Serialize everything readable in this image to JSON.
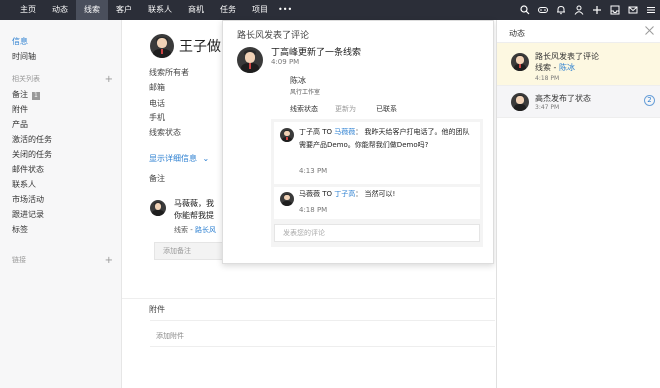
{
  "nav": {
    "items": [
      "主页",
      "动态",
      "线索",
      "客户",
      "联系人",
      "商机",
      "任务",
      "项目"
    ],
    "more": "•••"
  },
  "sidebar": {
    "top_items": [
      "信息",
      "时间轴"
    ],
    "group_label": "相关列表",
    "list_items": [
      "备注",
      "附件",
      "产品",
      "激活的任务",
      "关闭的任务",
      "邮件状态",
      "联系人",
      "市场活动",
      "跟进记录",
      "标签"
    ],
    "note_badge": "1",
    "link_group": "链接"
  },
  "main": {
    "name": "王子做",
    "fields": [
      "线索所有者",
      "邮箱",
      "电话",
      "手机",
      "线索状态"
    ],
    "show_more": "显示详细信息",
    "notes_title": "备注",
    "note_author": "马薇薇，我",
    "note_text": "你能帮我提",
    "note_ref_prefix": "线索 - ",
    "note_ref_link": "路长风",
    "add_note_placeholder": "添加备注",
    "attachments_title": "附件",
    "add_attachment": "添加附件"
  },
  "popup": {
    "title": "路长风发表了评论",
    "post_title": "丁高峰更新了一条线索",
    "post_time": "4:09 PM",
    "card_name": "陈冰",
    "card_company": "风行工作室",
    "card_field1": "线索状态",
    "card_field2": "更新为",
    "card_field3": "已联系",
    "comment1_author": "丁子高",
    "comment1_to": "TO",
    "comment1_target": "马薇薇",
    "comment1_line1": "：  我昨天给客户打电话了。他的团队",
    "comment1_line2": "需要产品Demo。你能帮我们做Demo吗?",
    "comment1_time": "4:13 PM",
    "comment2_author": "马薇薇",
    "comment2_to": "TO",
    "comment2_target": "丁子高",
    "comment2_text": "：  当然可以!",
    "comment2_time": "4:18 PM",
    "reply_placeholder": "发表您的评论"
  },
  "feed": {
    "title": "动态",
    "item1_title": "路长风发表了评论",
    "item1_sub_prefix": "线索 - ",
    "item1_sub_link": "陈冰",
    "item1_time": "4:18 PM",
    "item2_title": "高杰发布了状态",
    "item2_time": "3:47 PM",
    "item2_count": "2"
  },
  "colors": {
    "topbar": "#2b2e38",
    "link": "#2b7fd1",
    "highlight": "#fdf8e1"
  }
}
